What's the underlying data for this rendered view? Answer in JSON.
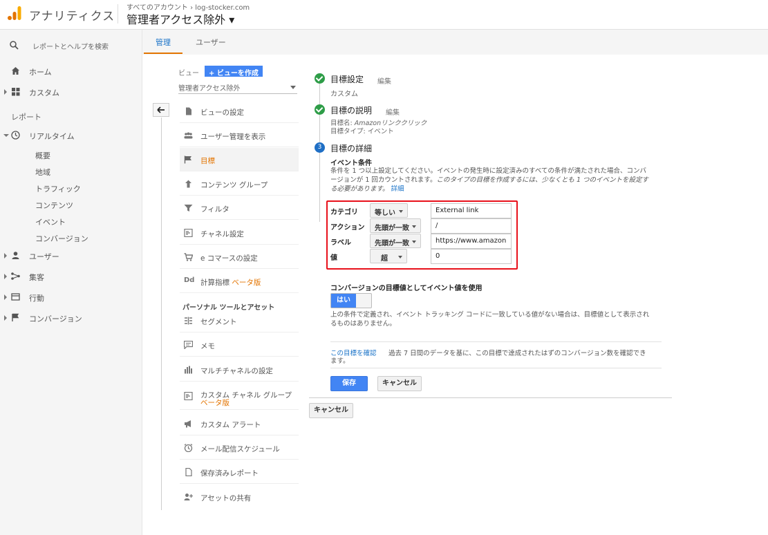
{
  "app": {
    "title": "アナリティクス",
    "breadcrumb": "すべてのアカウント › log-stocker.com",
    "view_title": "管理者アクセス除外 ▾"
  },
  "leftnav": {
    "search_placeholder": "レポートとヘルプを検索",
    "home": "ホーム",
    "custom": "カスタム",
    "reports_header": "レポート",
    "realtime": "リアルタイム",
    "realtime_sub": [
      "概要",
      "地域",
      "トラフィック",
      "コンテンツ",
      "イベント",
      "コンバージョン"
    ],
    "users": "ユーザー",
    "acquisition": "集客",
    "behavior": "行動",
    "conversions": "コンバージョン"
  },
  "tabs": {
    "admin": "管理",
    "user": "ユーザー"
  },
  "view_column": {
    "label": "ビュー",
    "create_button": "+ ビューを作成",
    "selected_view": "管理者アクセス除外",
    "items": [
      {
        "label": "ビューの設定",
        "icon": "doc-icon"
      },
      {
        "label": "ユーザー管理を表示",
        "icon": "people-icon"
      },
      {
        "label": "目標",
        "icon": "flag-icon"
      },
      {
        "label": "コンテンツ グループ",
        "icon": "person-run-icon"
      },
      {
        "label": "フィルタ",
        "icon": "filter-icon"
      },
      {
        "label": "チャネル設定",
        "icon": "channel-icon"
      },
      {
        "label": "e コマースの設定",
        "icon": "cart-icon"
      },
      {
        "label": "計算指標",
        "icon": "dd-icon",
        "badge": "ベータ版"
      }
    ],
    "personal_header": "パーソナル ツールとアセット",
    "personal_items": [
      {
        "label": "セグメント",
        "icon": "segment-icon"
      },
      {
        "label": "メモ",
        "icon": "memo-icon"
      },
      {
        "label": "マルチチャネルの設定",
        "icon": "bar-icon"
      },
      {
        "label": "カスタム チャネル グループ",
        "icon": "channel-icon",
        "badge": "ベータ版"
      },
      {
        "label": "カスタム アラート",
        "icon": "megaphone-icon"
      },
      {
        "label": "メール配信スケジュール",
        "icon": "clock-icon"
      },
      {
        "label": "保存済みレポート",
        "icon": "doc-icon"
      },
      {
        "label": "アセットの共有",
        "icon": "person-add-icon"
      }
    ]
  },
  "goal": {
    "step1_title": "目標設定",
    "step1_edit": "編集",
    "step1_value": "カスタム",
    "step2_title": "目標の説明",
    "step2_edit": "編集",
    "step2_name_label": "目標名: ",
    "step2_name": "Amazonリンククリック",
    "step2_type": "目標タイプ: イベント",
    "step3_num": "3",
    "step3_title": "目標の詳細",
    "event_conditions_header": "イベント条件",
    "desc_line1": "条件を 1 つ以上設定してください。イベントの発生時に設定済みのすべての条件が満たされた場合、コンバ",
    "desc_line2a": "ージョンが 1 回カウントされます。",
    "desc_line2b": "このタイプの目標を作成するには、少なくとも 1 つのイベントを設定す",
    "desc_line3": "る必要があります。",
    "desc_link": "詳細",
    "conditions": [
      {
        "label": "カテゴリ",
        "operator": "等しい",
        "value": "External link"
      },
      {
        "label": "アクション",
        "operator": "先頭が一致",
        "value": "/"
      },
      {
        "label": "ラベル",
        "operator": "先頭が一致",
        "value": "https://www.amazon"
      },
      {
        "label": "値",
        "operator": "超",
        "value": "0"
      }
    ],
    "use_event_value_label": "コンバージョンの目標値としてイベント値を使用",
    "toggle_on": "はい",
    "toggle_note_line1": "上の条件で定義され、イベント トラッキング コードに一致している値がない場合は、目標値として表示され",
    "toggle_note_line2": "るものはありません。",
    "verify_link": "この目標を確認",
    "verify_text_line1": "過去 7 日間のデータを基に、この目標で達成されたはずのコンバージョン数を確認でき",
    "verify_text_line2": "ます。",
    "save": "保存",
    "cancel": "キャンセル",
    "outer_cancel": "キャンセル"
  },
  "colors": {
    "accent": "#e37400",
    "primary": "#4285f4",
    "highlight": "#e8101a",
    "success": "#2e9d48"
  }
}
